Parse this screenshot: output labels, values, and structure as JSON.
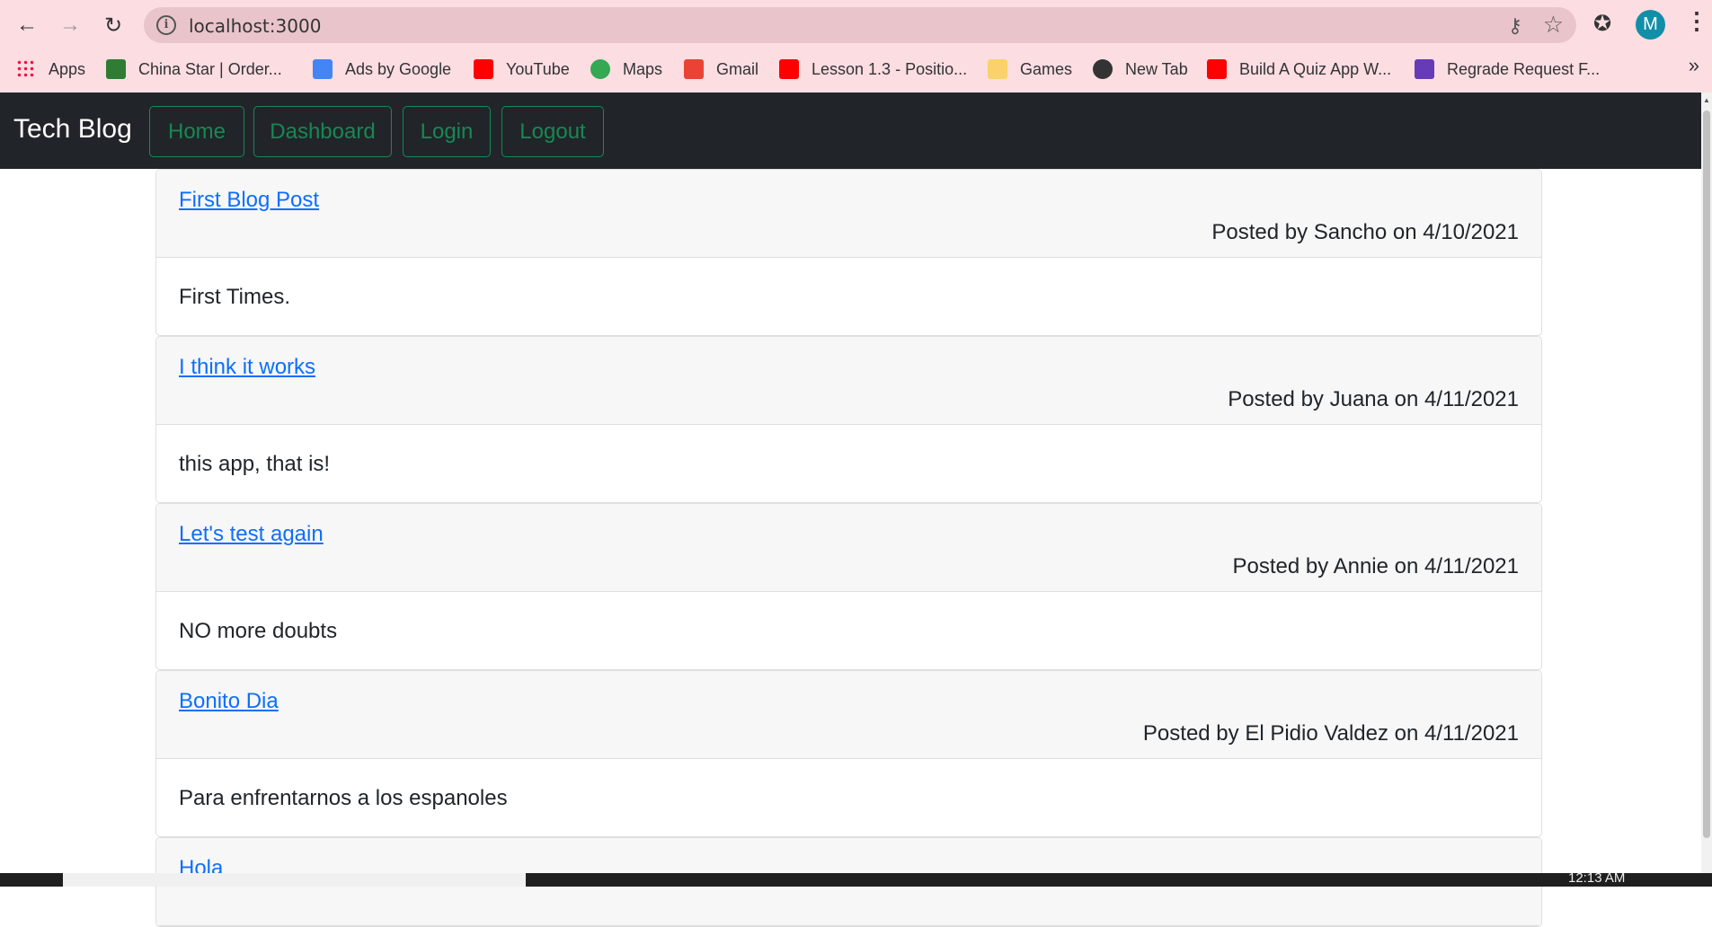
{
  "browser": {
    "url": "localhost:3000",
    "profile_initial": "M",
    "bookmarks": [
      {
        "label": "Apps",
        "icon": "apps-grid-icon",
        "color": "#e8453c"
      },
      {
        "label": "China Star | Order...",
        "icon": "bm-icon",
        "color": "#2e7d32"
      },
      {
        "label": "Ads by Google",
        "icon": "google-ads-icon",
        "color": "#4285f4"
      },
      {
        "label": "YouTube",
        "icon": "youtube-icon",
        "color": "#ff0000"
      },
      {
        "label": "Maps",
        "icon": "maps-pin-icon",
        "color": "#34a853"
      },
      {
        "label": "Gmail",
        "icon": "gmail-icon",
        "color": "#ea4335"
      },
      {
        "label": "Lesson 1.3 - Positio...",
        "icon": "youtube-icon",
        "color": "#ff0000"
      },
      {
        "label": "Games",
        "icon": "folder-icon",
        "color": "#f9d26b"
      },
      {
        "label": "New Tab",
        "icon": "globe-icon",
        "color": "#333333"
      },
      {
        "label": "Build A Quiz App W...",
        "icon": "youtube-icon",
        "color": "#ff0000"
      },
      {
        "label": "Regrade Request F...",
        "icon": "forms-icon",
        "color": "#673ab7"
      }
    ]
  },
  "nav": {
    "brand": "Tech Blog",
    "links": [
      "Home",
      "Dashboard",
      "Login",
      "Logout"
    ]
  },
  "posts": [
    {
      "title": "First Blog Post",
      "meta": "Posted by Sancho on 4/10/2021",
      "content": "First Times."
    },
    {
      "title": "I think it works",
      "meta": "Posted by Juana on 4/11/2021",
      "content": "this app, that is!"
    },
    {
      "title": "Let's test again",
      "meta": "Posted by Annie on 4/11/2021",
      "content": "NO more doubts"
    },
    {
      "title": "Bonito Dia",
      "meta": "Posted by El Pidio Valdez on 4/11/2021",
      "content": "Para enfrentarnos a los espanoles"
    },
    {
      "title": "Hola",
      "meta": "",
      "content": ""
    }
  ],
  "taskbar": {
    "clock": "12:13 AM"
  },
  "colors": {
    "link": "#0d6efd",
    "nav_bg": "#212529",
    "nav_btn": "#198754",
    "browser_bg": "#fbdde2"
  }
}
